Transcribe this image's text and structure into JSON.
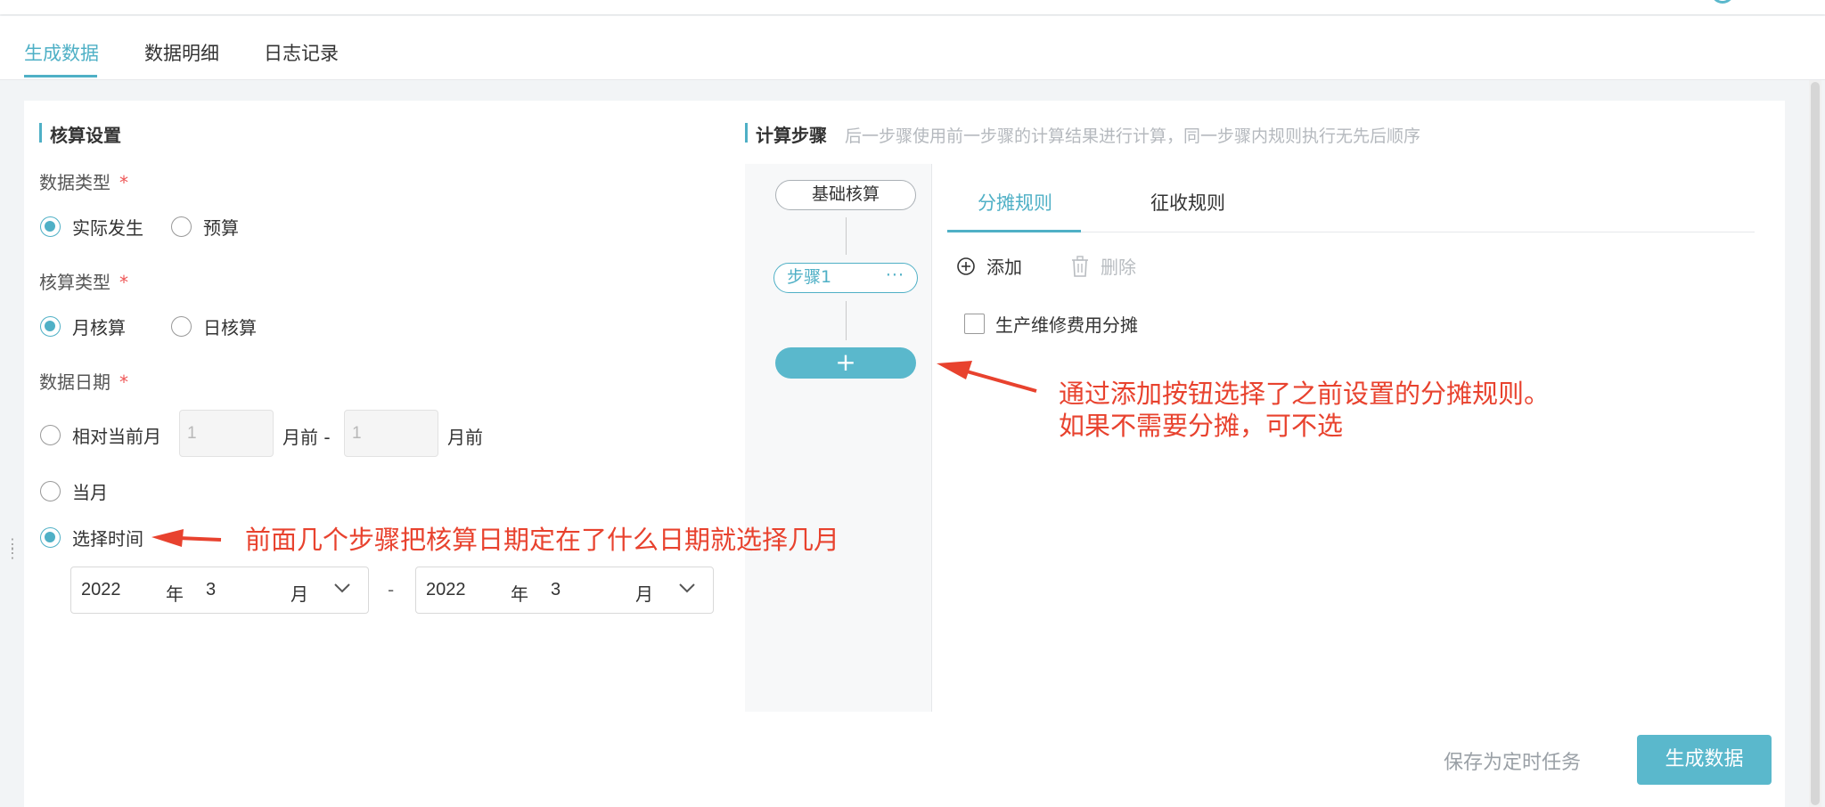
{
  "tabs": [
    "生成数据",
    "数据明细",
    "日志记录"
  ],
  "settings": {
    "title": "核算设置",
    "data_type": {
      "label": "数据类型",
      "required": "*",
      "options": [
        "实际发生",
        "预算"
      ],
      "selected": "实际发生"
    },
    "calc_type": {
      "label": "核算类型",
      "required": "*",
      "options": [
        "月核算",
        "日核算"
      ],
      "selected": "月核算"
    },
    "data_date": {
      "label": "数据日期",
      "required": "*",
      "relative_label": "相对当前月",
      "from_value": "1",
      "unit_before": "月前 -",
      "to_value": "1",
      "unit_after": "月前",
      "current_month_label": "当月",
      "select_time_label": "选择时间",
      "selected": "选择时间",
      "start": {
        "year": "2022",
        "year_unit": "年",
        "month": "3",
        "month_unit": "月"
      },
      "range_sep": "-",
      "end": {
        "year": "2022",
        "year_unit": "年",
        "month": "3",
        "month_unit": "月"
      }
    }
  },
  "steps": {
    "title": "计算步骤",
    "subtitle": "后一步骤使用前一步骤的计算结果进行计算，同一步骤内规则执行无先后顺序",
    "base_label": "基础核算",
    "step1_label": "步骤1",
    "step1_more": "···",
    "add_symbol": "+"
  },
  "rules": {
    "tabs": [
      "分摊规则",
      "征收规则"
    ],
    "active_tab": "分摊规则",
    "add_label": "添加",
    "delete_label": "删除",
    "items": [
      "生产维修费用分摊"
    ]
  },
  "annotations": {
    "left": "前面几个步骤把核算日期定在了什么日期就选择几月",
    "right_line1": "通过添加按钮选择了之前设置的分摊规则。",
    "right_line2": "如果不需要分摊，可不选"
  },
  "footer": {
    "save_label": "保存为定时任务",
    "generate_label": "生成数据"
  },
  "colors": {
    "accent": "#4fb0c6",
    "button": "#5ab8cc",
    "annotation": "#e8422e",
    "required": "#e55555"
  }
}
